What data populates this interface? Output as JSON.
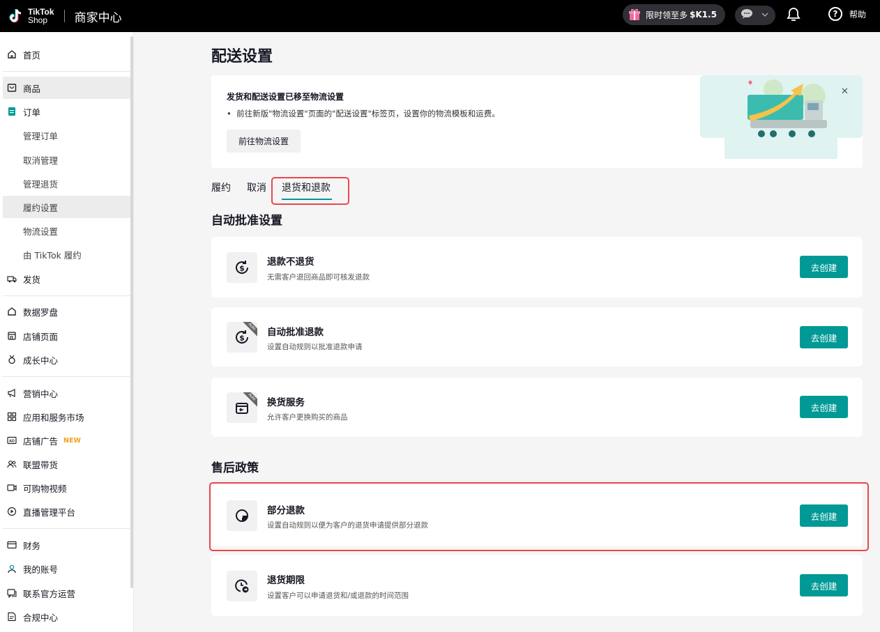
{
  "header": {
    "logo_line1": "TikTok",
    "logo_line2": "Shop",
    "app_title": "商家中心",
    "promo_text": "限时领至多",
    "promo_amount": "$K1.5",
    "help_label": "帮助"
  },
  "sidebar": {
    "items": [
      {
        "label": "首页",
        "icon": "home-icon"
      },
      {
        "label": "商品",
        "icon": "product-icon"
      },
      {
        "label": "订单",
        "icon": "order-icon"
      },
      {
        "label": "管理订单"
      },
      {
        "label": "取消管理"
      },
      {
        "label": "管理退货"
      },
      {
        "label": "履约设置"
      },
      {
        "label": "物流设置"
      },
      {
        "label": "由 TikTok 履约"
      },
      {
        "label": "发货",
        "icon": "truck-icon"
      },
      {
        "label": "数据罗盘",
        "icon": "compass-icon"
      },
      {
        "label": "店铺页面",
        "icon": "store-icon"
      },
      {
        "label": "成长中心",
        "icon": "medal-icon"
      },
      {
        "label": "营销中心",
        "icon": "megaphone-icon"
      },
      {
        "label": "应用和服务市场",
        "icon": "apps-icon"
      },
      {
        "label": "店铺广告",
        "icon": "ad-icon",
        "badge": "NEW"
      },
      {
        "label": "联盟带货",
        "icon": "affiliate-icon"
      },
      {
        "label": "可购物视频",
        "icon": "video-icon"
      },
      {
        "label": "直播管理平台",
        "icon": "live-icon"
      },
      {
        "label": "财务",
        "icon": "finance-icon"
      },
      {
        "label": "我的账号",
        "icon": "account-icon"
      },
      {
        "label": "联系官方运营",
        "icon": "contact-icon"
      },
      {
        "label": "合规中心",
        "icon": "compliance-icon"
      }
    ]
  },
  "page": {
    "title": "配送设置",
    "banner": {
      "title": "发货和配送设置已移至物流设置",
      "bullet": "前往新版\"物流设置\"页面的\"配送设置\"标签页，设置你的物流模板和运费。",
      "button": "前往物流设置"
    },
    "tabs": [
      "履约",
      "取消",
      "退货和退款"
    ],
    "active_tab": "退货和退款",
    "section1_title": "自动批准设置",
    "section2_title": "售后政策",
    "auto_tag": "Auto",
    "cards": [
      {
        "title": "退款不退货",
        "desc": "无需客户退回商品即可核发退款",
        "button": "去创建",
        "icon": "refund-dollar-icon"
      },
      {
        "title": "自动批准退款",
        "desc": "设置自动规则以批准退款申请",
        "button": "去创建",
        "icon": "auto-refund-icon"
      },
      {
        "title": "换货服务",
        "desc": "允许客户更换购买的商品",
        "button": "去创建",
        "icon": "exchange-icon"
      },
      {
        "title": "部分退款",
        "desc": "设置自动规则以便为客户的退货申请提供部分退款",
        "button": "去创建",
        "icon": "partial-refund-icon"
      },
      {
        "title": "退货期限",
        "desc": "设置客户可以申请退货和/或退款的时间范围",
        "button": "去创建",
        "icon": "return-period-icon"
      }
    ]
  },
  "colors": {
    "accent": "#009995",
    "highlight": "#e8474c",
    "topbar": "#000000"
  }
}
